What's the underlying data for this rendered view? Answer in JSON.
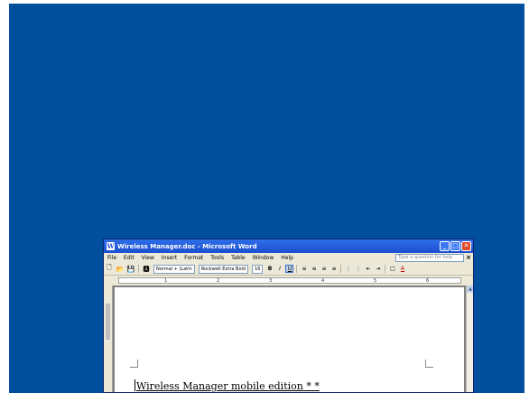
{
  "window": {
    "title": "Wireless Manager.doc - Microsoft Word",
    "icon_letter": "W"
  },
  "menu": {
    "items": [
      "File",
      "Edit",
      "View",
      "Insert",
      "Format",
      "Tools",
      "Table",
      "Window",
      "Help"
    ],
    "help_placeholder": "Type a question for help",
    "close_glyph": "×"
  },
  "toolbar": {
    "style": "Normal + (Latin",
    "font": "Rockwell Extra Bold",
    "size": "16",
    "bold": "B",
    "italic": "I",
    "underline": "U",
    "font_color_glyph": "A"
  },
  "ruler": {
    "numbers": [
      "1",
      "2",
      "3",
      "4",
      "5",
      "6"
    ]
  },
  "document": {
    "text": "Wireless Manager mobile edition * *"
  },
  "icons": {
    "new": "new-document-icon",
    "open": "open-icon",
    "save": "save-icon",
    "styles": "styles-icon"
  }
}
